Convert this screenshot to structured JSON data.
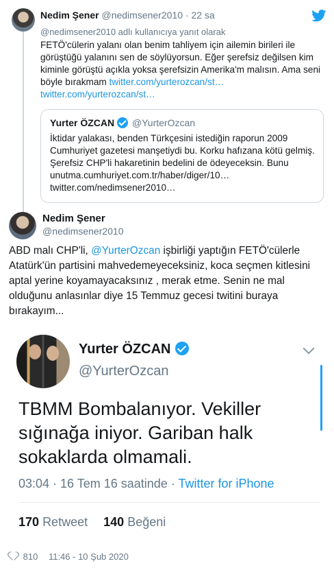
{
  "reply": {
    "name": "Nedim Şener",
    "handle": "@nedimsener2010",
    "dot": "·",
    "time": "22 sa",
    "replying_to": "@nedimsener2010 adlı kullanıcıya yanıt olarak",
    "text_1": "FETÖ'cülerin yalanı olan benim tahliyem için ailemin birileri ile görüştüğü yalanını sen de söylüyorsun. Eğer şerefsiz değilsen kim kiminle görüştü açıkla yoksa şerefsizin Amerika'm malısın. Ama seni böyle bırakmam ",
    "link_1": "twitter.com/yurterozcan/st…",
    "link_2": "twitter.com/yurterozcan/st…",
    "icon": "twitter-bird-icon"
  },
  "quote": {
    "name": "Yurter ÖZCAN",
    "handle": "@YurterOzcan",
    "text": "İktidar yalakası, benden Türkçesini istediğin raporun 2009 Cumhuriyet gazetesi manşetiydi bu. Korku hafızana kötü gelmiş. Şerefsiz CHP'li hakaretinin bedelini de ödeyeceksin. Bunu unutma.cumhuriyet.com.tr/haber/diger/10… twitter.com/nedimsener2010…"
  },
  "main": {
    "name": "Nedim Şener",
    "handle": "@nedimsener2010",
    "text_before": "ABD malı CHP'li, ",
    "mention": "@YurterOzcan",
    "text_after": " işbirliği yaptığın FETÖ'cülerle Atatürk'ün partisini mahvedemeyeceksiniz, koca seçmen kitlesini aptal yerine koyamayacaksınız , merak etme. Senin ne mal olduğunu anlasınlar diye 15 Temmuz gecesi twitini buraya bırakayım..."
  },
  "screenshot": {
    "name": "Yurter ÖZCAN",
    "handle": "@YurterOzcan",
    "text": "TBMM Bombalanıyor. Vekiller sığınağa iniyor. Gariban halk sokaklarda olmamali.",
    "time": "03:04 · 16 Tem 16 saatinde · ",
    "source": "Twitter for iPhone",
    "retweets": "170",
    "retweet_label": "Retweet",
    "likes": "140",
    "like_label": "Beğeni"
  },
  "footer": {
    "likes": "810",
    "time": "11:46 - 10 Şub 2020",
    "icon": "heart-icon"
  },
  "colors": {
    "link": "#1b95e0",
    "muted": "#657786",
    "text": "#14171a",
    "verified": "#1da1f2",
    "border": "#ccd6dd"
  }
}
